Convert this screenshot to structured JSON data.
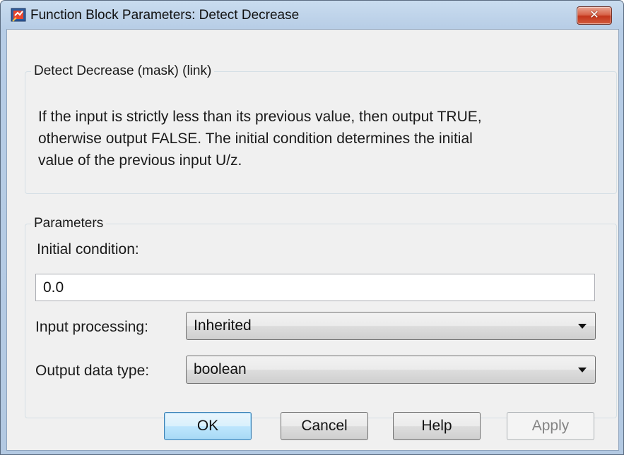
{
  "window": {
    "title": "Function Block Parameters: Detect Decrease",
    "close_symbol": "✕",
    "icon": "simulink-block-icon"
  },
  "description": {
    "group_label": "Detect Decrease (mask) (link)",
    "lines": [
      "If the input is strictly less than its previous value, then output TRUE,",
      "otherwise output FALSE.  The initial condition determines the initial",
      "value of the previous input U/z."
    ]
  },
  "parameters": {
    "group_label": "Parameters",
    "initial_condition": {
      "label": "Initial condition:",
      "value": "0.0"
    },
    "input_processing": {
      "label": "Input processing:",
      "value": "Inherited"
    },
    "output_data_type": {
      "label": "Output data type:",
      "value": "boolean"
    }
  },
  "buttons": {
    "ok": "OK",
    "cancel": "Cancel",
    "help": "Help",
    "apply": "Apply"
  },
  "colors": {
    "close_button": "#c4361c",
    "default_button_border": "#3c7fb1",
    "dialog_background": "#f0f0f0"
  }
}
